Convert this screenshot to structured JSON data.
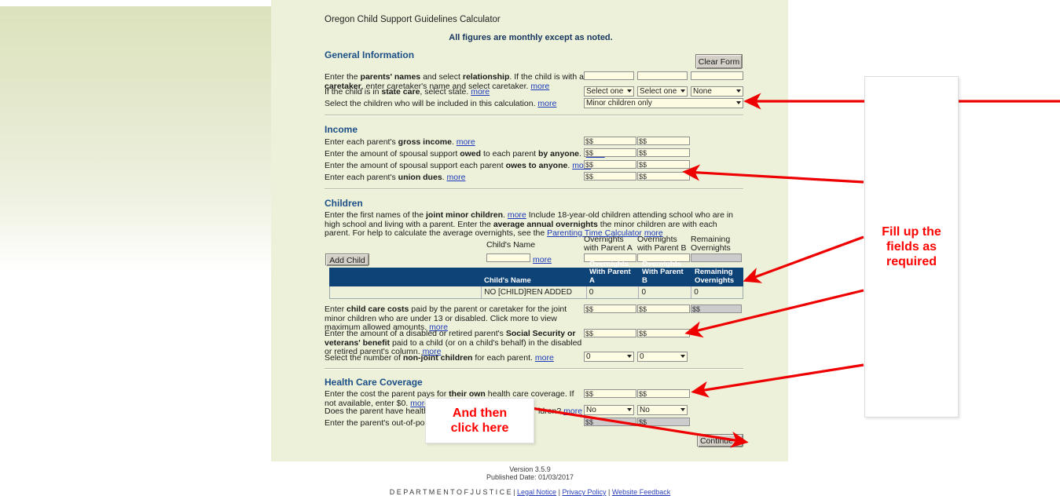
{
  "page": {
    "title": "Oregon Child Support Guidelines Calculator",
    "subtitle": "All figures are monthly except as noted.",
    "accent_blue": "#1c4f87",
    "table_header_blue": "#0d4377",
    "panel_bg": "#edf1d9",
    "field_bg": "#fdfbe2",
    "annotation_red": "#ff0000"
  },
  "general": {
    "heading": "General Information",
    "clear_form_label": "Clear Form",
    "row1_text_a": "Enter the ",
    "row1_text_full": "Enter the parents' names and select relationship. If the child is with a caretaker, enter caretaker's name and select caretaker.",
    "row1_more": "more",
    "row2_text": "If the child is in state care, select state.",
    "row2_more": "more",
    "row3_text": "Select the children who will be included in this calculation.",
    "row3_more": "more",
    "name_fields": [
      "",
      "",
      ""
    ],
    "selects": [
      "Select one",
      "Select one",
      "None"
    ],
    "children_included_select": "Minor children only"
  },
  "income": {
    "heading": "Income",
    "rows": [
      {
        "text": "Enter each parent's gross income.",
        "more": "more",
        "fields": [
          "$",
          "$"
        ]
      },
      {
        "text": "Enter the amount of spousal support owed to each parent by anyone.",
        "more": "more",
        "fields": [
          "$",
          "$"
        ]
      },
      {
        "text": "Enter the amount of spousal support each parent owes to anyone.",
        "more": "more",
        "fields": [
          "$",
          "$"
        ]
      },
      {
        "text": "Enter each parent's union dues.",
        "more": "more",
        "fields": [
          "$",
          "$"
        ]
      }
    ]
  },
  "children": {
    "heading": "Children",
    "intro_line1": "Enter the first names of the joint minor children.",
    "intro_more1": "more",
    "intro_line1b": "Include 18-year-old children attending school who are in high school and living with a",
    "intro_line2": "parent. Enter the average annual overnights the minor children are with each parent. For help to calculate the average overnights, see the",
    "intro_link": "Parenting Time Calculator",
    "intro_more2": "more",
    "add_child_label": "Add Child",
    "entry_col_headers": [
      "Child's Name",
      "Overnights with Parent A",
      "Overnights with Parent B",
      "Remaining Overnights"
    ],
    "entry_more": "more",
    "entry_values": [
      "",
      "",
      "",
      ""
    ],
    "table": {
      "headers": [
        "",
        "Child's Name",
        "Overnights With Parent A",
        "Overnights With Parent B",
        "Remaining Overnights"
      ],
      "rows": [
        [
          "",
          "NO [CHILD]REN ADDED",
          "0",
          "0",
          "0"
        ]
      ]
    },
    "childcare_text_line1": "Enter child care costs paid by the parent or caretaker for the joint minor children who",
    "childcare_text_line2": "are under 13 or disabled. Click more to view maximum allowed amounts.",
    "childcare_more": "more",
    "childcare_fields": [
      "$",
      "$",
      "$"
    ],
    "ssa_text_line1": "Enter the amount of a disabled or retired parent's Social Security or veterans' benefit",
    "ssa_text_line2": "paid to a child (or on a child's behalf) in the disabled or retired parent's column.",
    "ssa_more": "more",
    "ssa_fields": [
      "$",
      "$"
    ],
    "nonjoint_text": "Select the number of non-joint children for each parent.",
    "nonjoint_more": "more",
    "nonjoint_selects": [
      "0",
      "0"
    ]
  },
  "health": {
    "heading": "Health Care Coverage",
    "row1_line1": "Enter the cost the parent pays for their own health care coverage. If not available, enter",
    "row1_line2": "$0.",
    "row1_more": "more",
    "row1_fields": [
      "$",
      "$"
    ],
    "row2_text_left": "Does the parent have health car",
    "row2_text_right": "ldren?",
    "row2_more": "more",
    "row2_selects": [
      "No",
      "No"
    ],
    "row3_text": "Enter the parent's out-of-pocket c",
    "row3_fields": [
      "$",
      "$"
    ],
    "continue_label": "Continue >"
  },
  "footer": {
    "version": "Version 3.5.9",
    "published": "Published Date: 01/03/2017",
    "dept": "D E P A R T M E N T   O F   J U S T I C E",
    "sep": "|",
    "links": [
      "Legal Notice",
      "Privacy Policy",
      "Website Feedback"
    ]
  },
  "annotations": {
    "right_box_text_line1": "Fill up the",
    "right_box_text_line2": "fields as",
    "right_box_text_line3": "required",
    "click_box_text_line1": "And then",
    "click_box_text_line2": "click here"
  }
}
